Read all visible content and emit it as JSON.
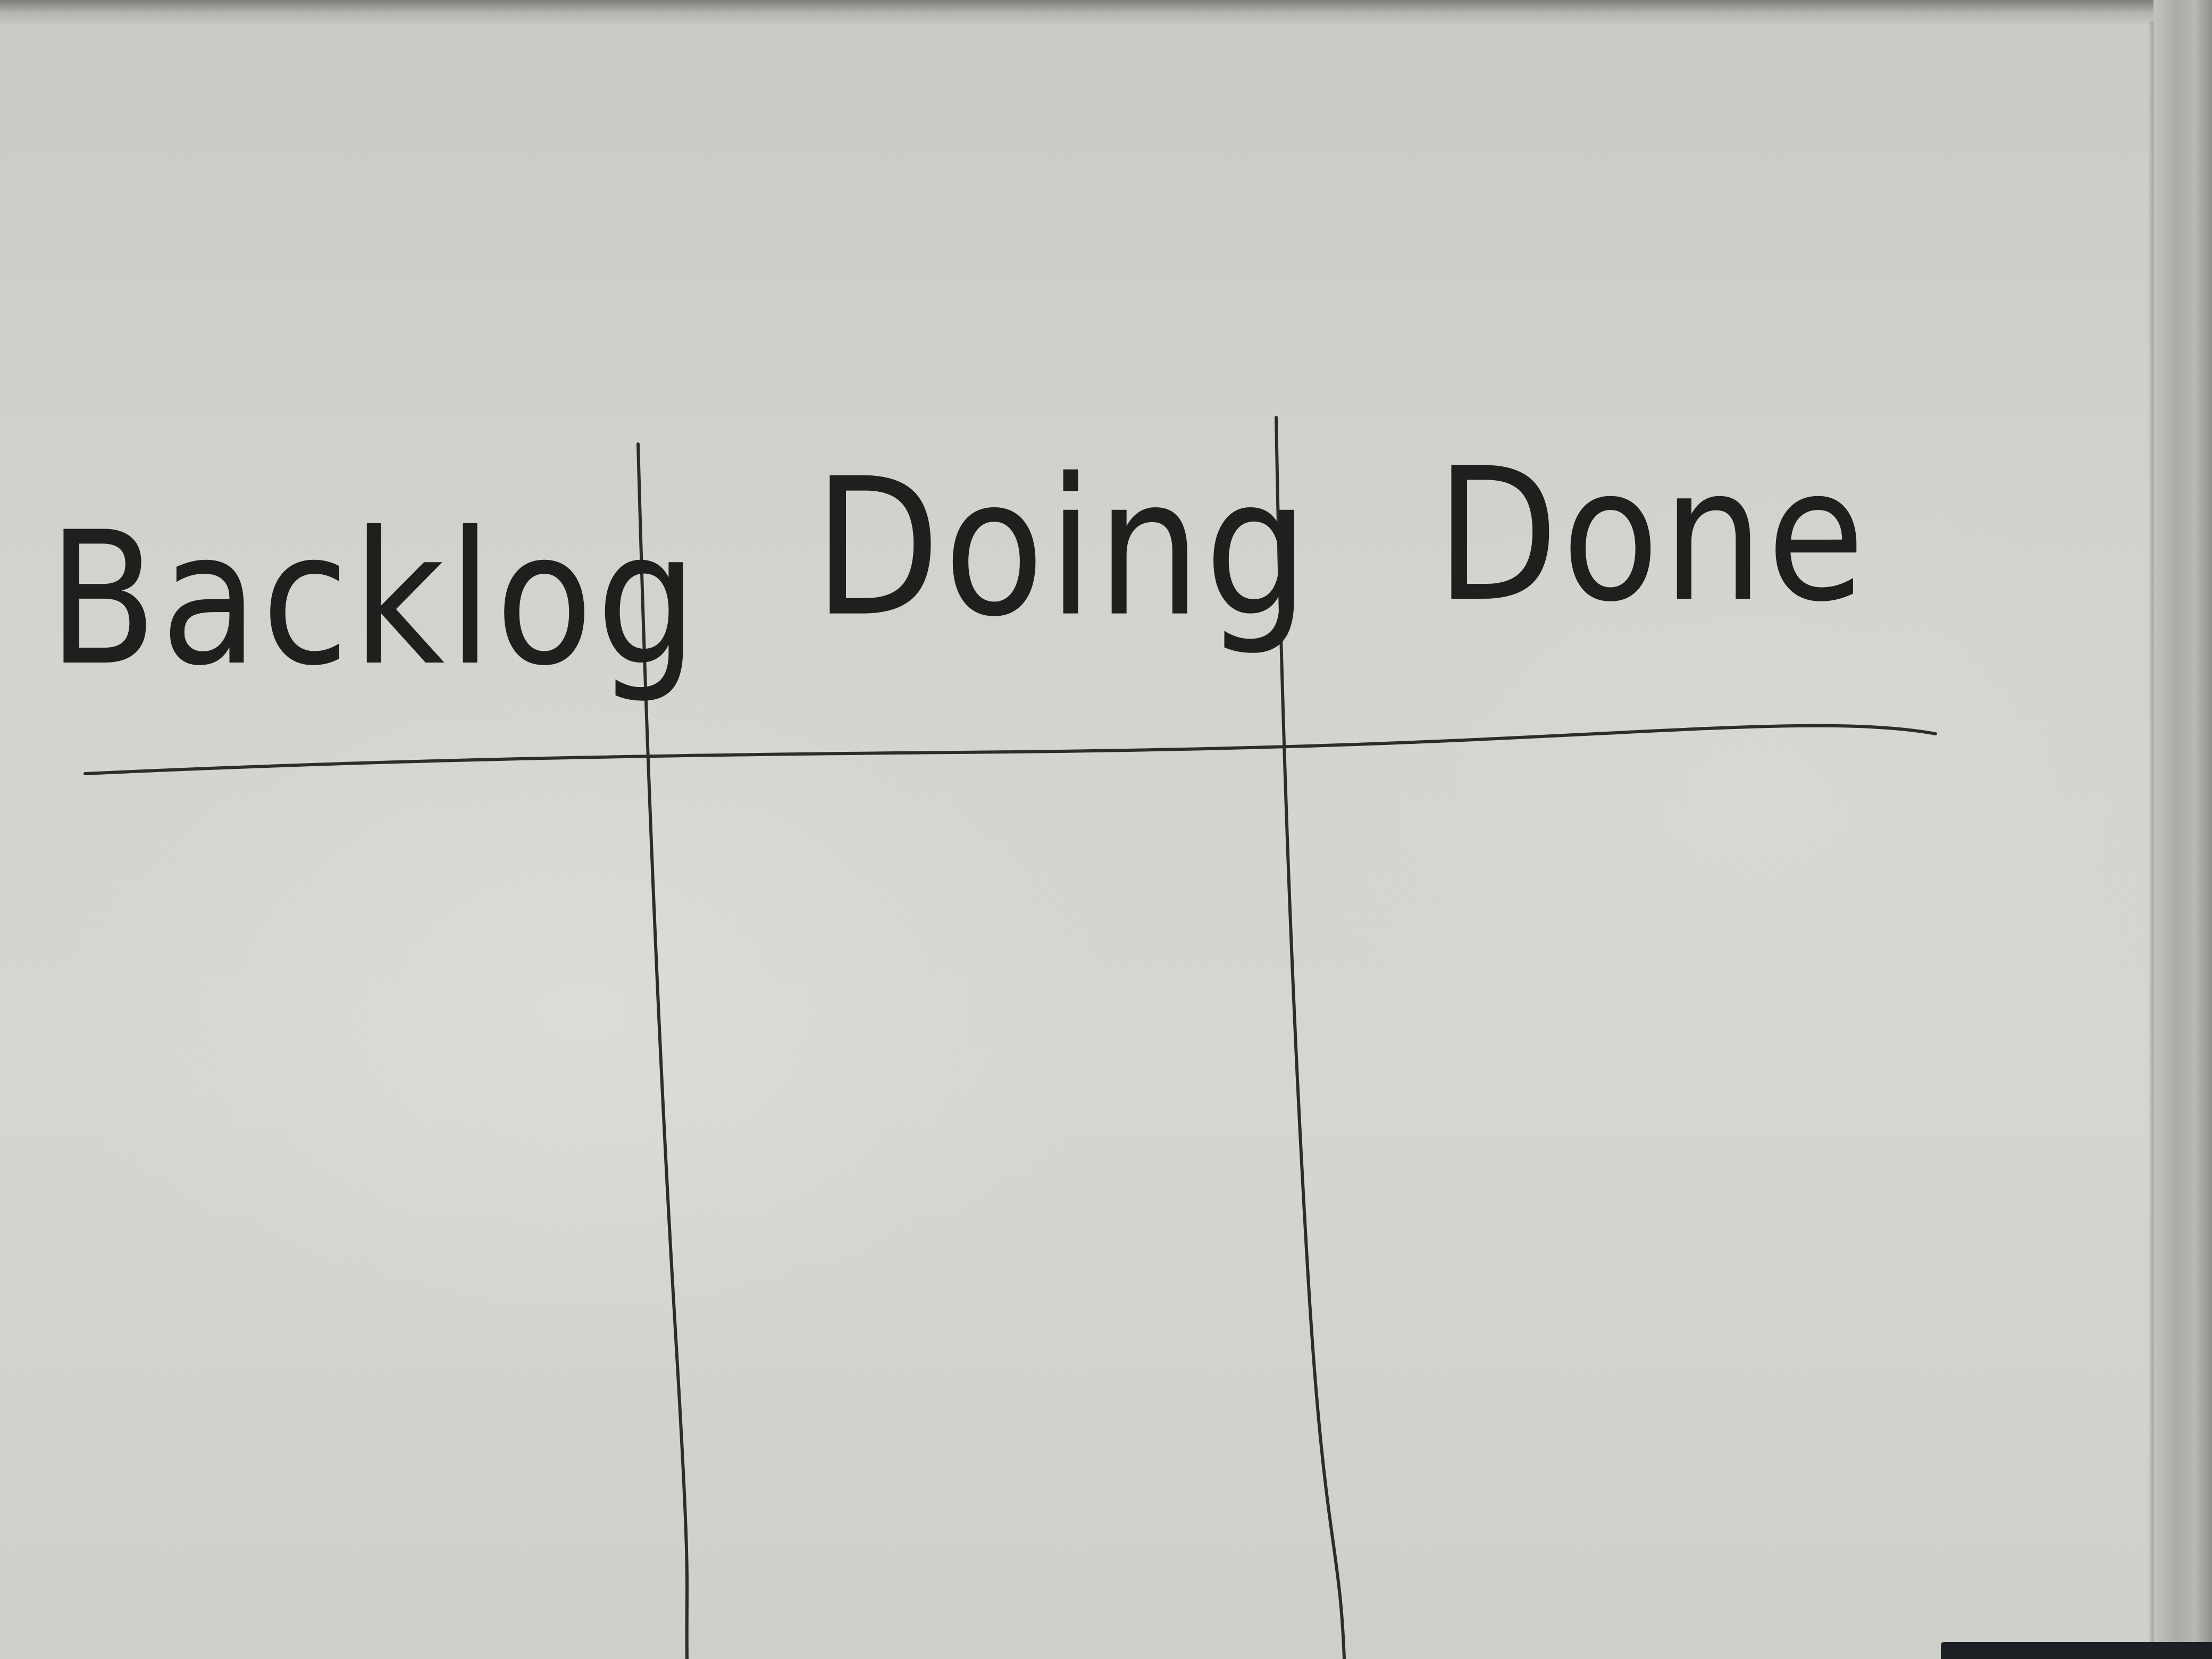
{
  "board": {
    "columns": [
      {
        "label": "Backlog"
      },
      {
        "label": "Doing"
      },
      {
        "label": "Done"
      }
    ]
  },
  "colors": {
    "board_surface": "#d4d4cf",
    "ink": "#2c2c2a",
    "frame": "#a9aba6"
  }
}
